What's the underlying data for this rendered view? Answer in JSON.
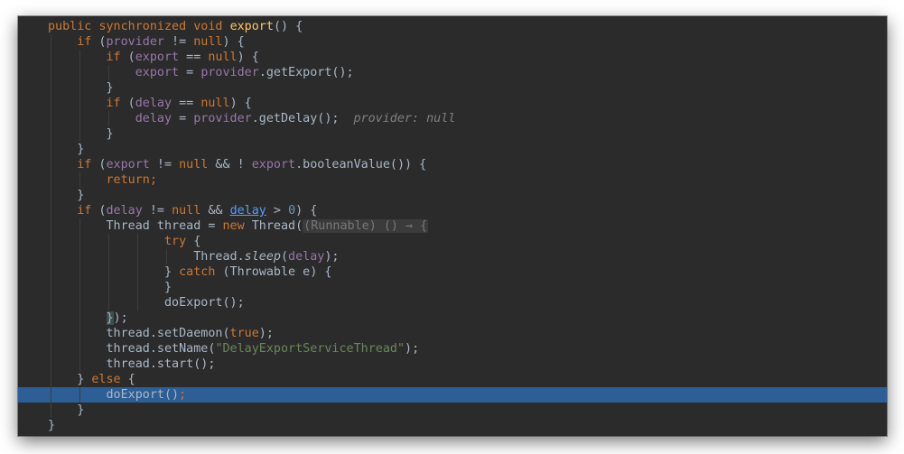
{
  "editor": {
    "lines": [
      {
        "indent": 0,
        "text": "public synchronized void export() {"
      },
      {
        "indent": 1,
        "text": "if (provider != null) {"
      },
      {
        "indent": 2,
        "text": "if (export == null) {"
      },
      {
        "indent": 3,
        "text": "export = provider.getExport();"
      },
      {
        "indent": 2,
        "text": "}"
      },
      {
        "indent": 2,
        "text": "if (delay == null) {"
      },
      {
        "indent": 3,
        "text": "delay = provider.getDelay();",
        "hint": "provider: null"
      },
      {
        "indent": 2,
        "text": "}"
      },
      {
        "indent": 1,
        "text": "}"
      },
      {
        "indent": 1,
        "text": "if (export != null && ! export.booleanValue()) {"
      },
      {
        "indent": 2,
        "text": "return;"
      },
      {
        "indent": 1,
        "text": "}"
      },
      {
        "indent": 1,
        "text": "if (delay != null && delay > 0) {"
      },
      {
        "indent": 2,
        "text": "Thread thread = new Thread((Runnable) () → {"
      },
      {
        "indent": 4,
        "text": "try {"
      },
      {
        "indent": 5,
        "text": "Thread.sleep(delay);"
      },
      {
        "indent": 4,
        "text": "} catch (Throwable e) {"
      },
      {
        "indent": 4,
        "text": "}"
      },
      {
        "indent": 4,
        "text": "doExport();"
      },
      {
        "indent": 2,
        "text": "});"
      },
      {
        "indent": 2,
        "text": "thread.setDaemon(true);"
      },
      {
        "indent": 2,
        "text": "thread.setName(\"DelayExportServiceThread\");"
      },
      {
        "indent": 2,
        "text": "thread.start();"
      },
      {
        "indent": 1,
        "text": "} else {"
      },
      {
        "indent": 2,
        "text": "doExport();",
        "current": true
      },
      {
        "indent": 1,
        "text": "}"
      },
      {
        "indent": 0,
        "text": "}"
      }
    ]
  },
  "colors": {
    "background": "#2b2b2b",
    "keyword": "#cc7832",
    "method_declaration": "#ffc66d",
    "field": "#9876aa",
    "string": "#6a8759",
    "number": "#6897bb",
    "default_text": "#a9b7c6",
    "current_line": "#2d5e95",
    "inline_hint": "#808080"
  }
}
